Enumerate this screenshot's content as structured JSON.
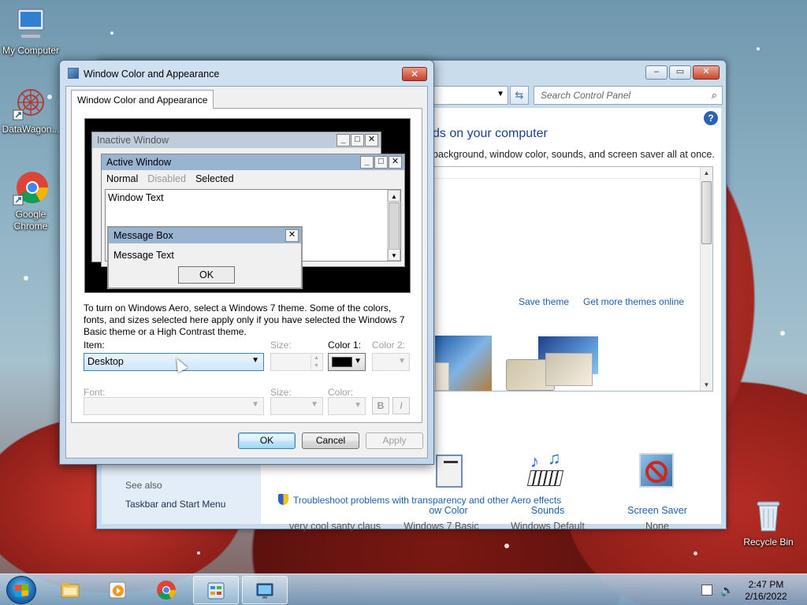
{
  "desktop": {
    "icons": [
      {
        "label": "My Computer"
      },
      {
        "label": "DataWagon..."
      },
      {
        "label": "Google Chrome"
      },
      {
        "label": "Recycle Bin"
      }
    ]
  },
  "control_panel": {
    "search_placeholder": "Search Control Panel",
    "heading": "ds on your computer",
    "subheading": "background, window color, sounds, and screen saver all at once.",
    "save_theme": "Save theme",
    "more_themes": "Get more themes online",
    "items": [
      {
        "title": "ow Color",
        "value": "Windows 7 Basic"
      },
      {
        "title": "Sounds",
        "value": "Windows Default"
      },
      {
        "title": "Screen Saver",
        "value": "None"
      }
    ],
    "desktop_bg_value": "very cool santy claus",
    "see_also": "See also",
    "taskbar_link": "Taskbar and Start Menu",
    "troubleshoot": "Troubleshoot problems with transparency and other Aero effects"
  },
  "dialog": {
    "title": "Window Color and Appearance",
    "tab": "Window Color and Appearance",
    "preview": {
      "inactive_title": "Inactive Window",
      "active_title": "Active Window",
      "menu_normal": "Normal",
      "menu_disabled": "Disabled",
      "menu_selected": "Selected",
      "window_text": "Window Text",
      "msgbox_title": "Message Box",
      "msgbox_text": "Message Text",
      "msgbox_ok": "OK"
    },
    "info": "To turn on Windows Aero, select a Windows 7 theme.  Some of the colors, fonts, and sizes selected here apply only if you have selected the Windows 7 Basic theme or a High Contrast theme.",
    "labels": {
      "item": "Item:",
      "size1": "Size:",
      "color1": "Color 1:",
      "color2": "Color 2:",
      "font": "Font:",
      "size2": "Size:",
      "color": "Color:"
    },
    "item_value": "Desktop",
    "color1_value": "#000000",
    "bold": "B",
    "italic": "I",
    "buttons": {
      "ok": "OK",
      "cancel": "Cancel",
      "apply": "Apply"
    }
  },
  "taskbar": {
    "time": "2:47 PM",
    "date": "2/16/2022"
  }
}
